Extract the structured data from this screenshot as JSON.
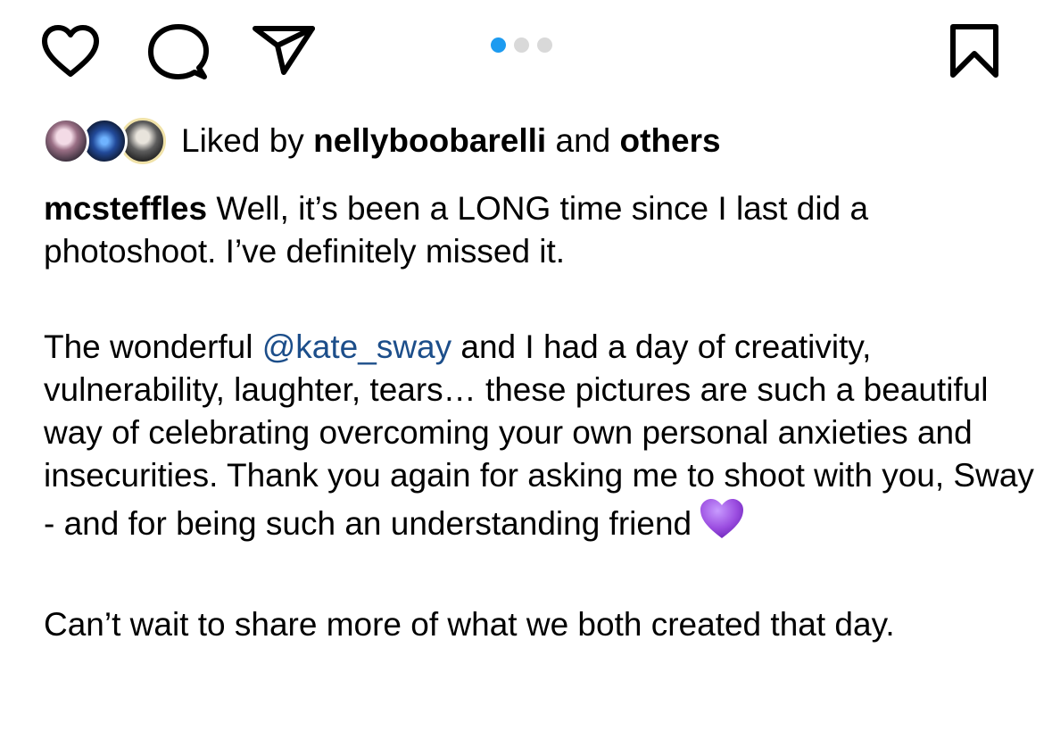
{
  "actions": {
    "like_icon": "heart-outline-icon",
    "comment_icon": "comment-bubble-icon",
    "share_icon": "paper-plane-icon",
    "save_icon": "bookmark-icon"
  },
  "carousel": {
    "count": 3,
    "active_index": 0,
    "active_color": "#1d9bf0",
    "inactive_color": "#d9d9d9"
  },
  "likes": {
    "prefix": "Liked by",
    "user": "nellyboobarelli",
    "connector": "and",
    "others": "others"
  },
  "caption": {
    "username": "mcsteffles",
    "line1": "Well, it’s been a LONG time since I last did a photoshoot. I’ve definitely missed it.",
    "para2_before": "The wonderful",
    "mention": "@kate_sway",
    "para2_after": "and I had a day of creativity, vulnerability, laughter, tears… these pictures are such a beautiful way of celebrating overcoming your own personal anxieties and insecurities. Thank you again for asking me to shoot with you, Sway - and for being such an understanding friend",
    "emoji": "purple-heart-icon",
    "para3": "Can’t wait to share more of what we both created that day."
  },
  "colors": {
    "mention": "#1c4e8a",
    "text": "#000000",
    "emoji": "#9b4de0"
  }
}
